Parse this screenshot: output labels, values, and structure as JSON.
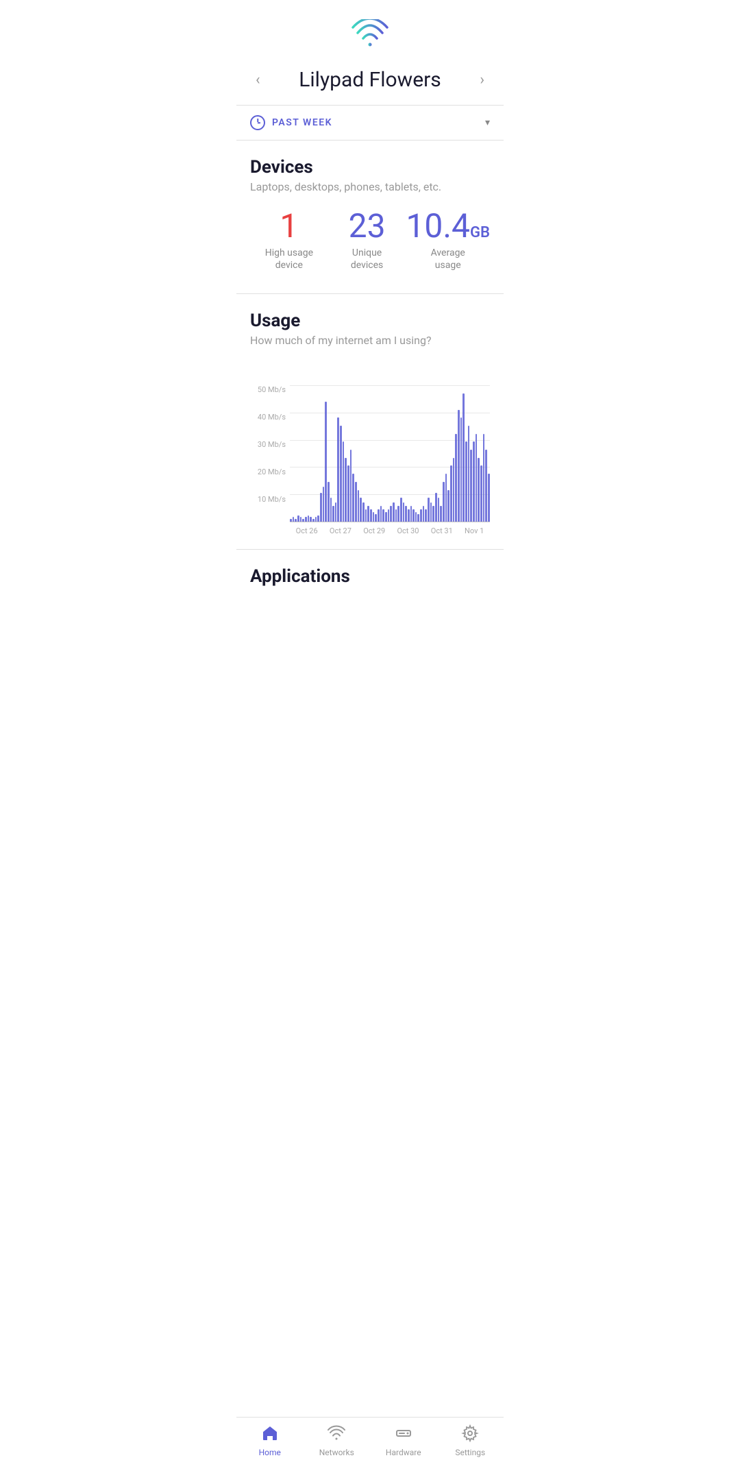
{
  "header": {
    "title": "Lilypad Flowers",
    "prev_arrow": "‹",
    "next_arrow": "›"
  },
  "time_filter": {
    "label": "PAST WEEK",
    "dropdown_arrow": "▾"
  },
  "devices": {
    "title": "Devices",
    "subtitle": "Laptops, desktops, phones, tablets, etc.",
    "stats": [
      {
        "value": "1",
        "color": "red",
        "label": "High usage\ndevice"
      },
      {
        "value": "23",
        "color": "purple",
        "label": "Unique\ndevices"
      },
      {
        "value": "10.4",
        "unit": "GB",
        "color": "purple",
        "label": "Average\nusage"
      }
    ]
  },
  "usage": {
    "title": "Usage",
    "subtitle": "How much of my internet am I using?",
    "y_labels": [
      "50 Mb/s",
      "40 Mb/s",
      "30 Mb/s",
      "20 Mb/s",
      "10 Mb/s",
      ""
    ],
    "x_labels": [
      "Oct 26",
      "Oct 27",
      "Oct 29",
      "Oct 30",
      "Oct 31",
      "Nov 1"
    ],
    "bars": [
      2,
      3,
      2,
      4,
      3,
      2,
      3,
      4,
      3,
      2,
      3,
      4,
      18,
      22,
      75,
      25,
      15,
      10,
      12,
      65,
      60,
      50,
      40,
      35,
      45,
      30,
      25,
      20,
      15,
      12,
      8,
      10,
      8,
      6,
      5,
      8,
      10,
      8,
      6,
      8,
      10,
      12,
      8,
      10,
      15,
      12,
      10,
      8,
      10,
      8,
      6,
      5,
      8,
      10,
      8,
      15,
      12,
      10,
      18,
      15,
      10,
      25,
      30,
      20,
      35,
      40,
      55,
      70,
      65,
      80,
      50,
      60,
      45,
      50,
      55,
      40,
      35,
      55,
      45,
      30
    ]
  },
  "applications": {
    "title": "Applications"
  },
  "nav": {
    "items": [
      {
        "id": "home",
        "label": "Home",
        "active": true
      },
      {
        "id": "networks",
        "label": "Networks",
        "active": false
      },
      {
        "id": "hardware",
        "label": "Hardware",
        "active": false
      },
      {
        "id": "settings",
        "label": "Settings",
        "active": false
      }
    ]
  }
}
